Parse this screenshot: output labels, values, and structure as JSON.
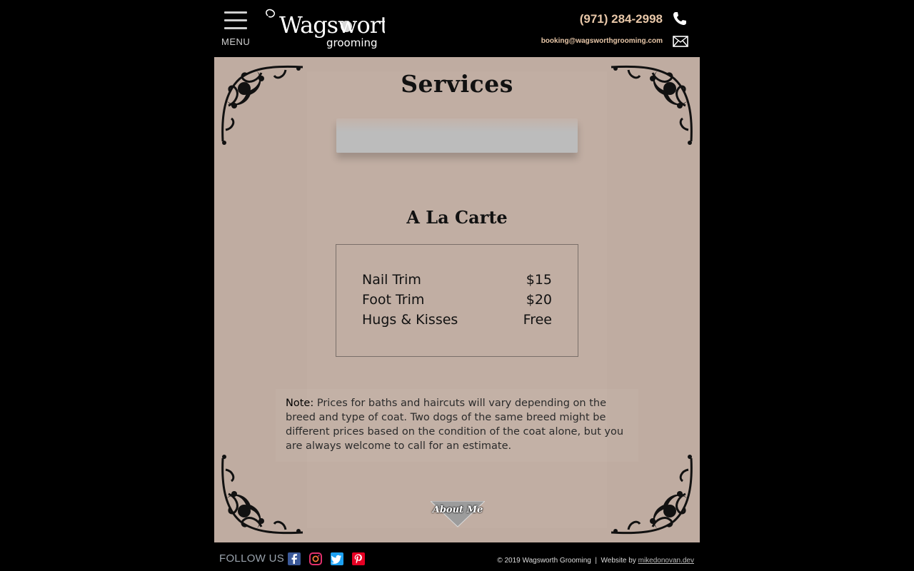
{
  "header": {
    "menu_label": "MENU",
    "logo_text_main": "Wagsworth",
    "logo_text_sub": "grooming",
    "phone": "(971) 284-2998",
    "email": "booking@wagsworthgrooming.com"
  },
  "main": {
    "title": "Services",
    "a_la_carte_title": "A La Carte",
    "a_la_carte_items": [
      {
        "name": "Nail Trim",
        "price": "$15"
      },
      {
        "name": "Foot Trim",
        "price": "$20"
      },
      {
        "name": "Hugs & Kisses",
        "price": "Free"
      }
    ],
    "note_label": "Note:",
    "note_text": "Prices for baths and haircuts will vary depending on the breed and type of coat. Two dogs of the same breed might be different prices based on the condition of the coat alone, but you are always welcome to call for an estimate.",
    "about_button": "About Me"
  },
  "footer": {
    "follow_label": "FOLLOW US",
    "copyright": "© 2019 Wagsworth Grooming  |  Website by ",
    "credit_link": "mikedonovan.dev",
    "social_icons": [
      "facebook-icon",
      "instagram-icon",
      "twitter-icon",
      "pinterest-icon"
    ]
  },
  "colors": {
    "page_bg": "#000000",
    "content_bg": "#bfaca1",
    "contact_text": "#e8c7a8",
    "footer_text": "#9aa3ad",
    "facebook": "#3b5998",
    "twitter": "#1da1f2",
    "pinterest": "#e60023"
  }
}
